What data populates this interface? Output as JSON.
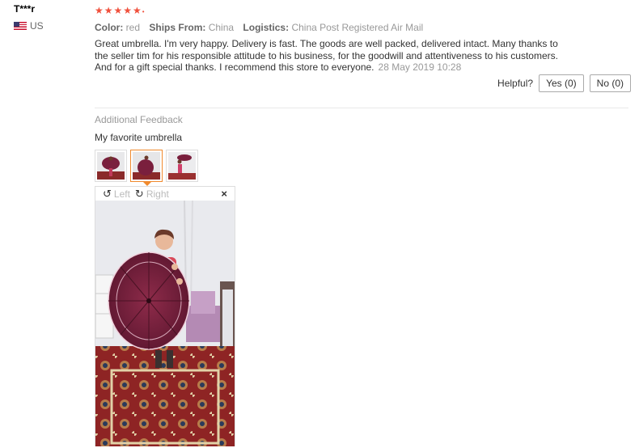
{
  "user": {
    "name": "T***r",
    "country": "US"
  },
  "review": {
    "rating": 5,
    "stars": "★★★★★",
    "color_label": "Color:",
    "color_value": "red",
    "ships_label": "Ships From:",
    "ships_value": "China",
    "logistics_label": "Logistics:",
    "logistics_value": "China Post Registered Air Mail",
    "text": "Great umbrella. I'm very happy. Delivery is fast. The goods are well packed, delivered intact. Many thanks to the seller tim for his responsible attitude to his business, for the goodwill and attentiveness to his customers. And for a gift special thanks. I recommend this store to everyone.",
    "date": "28 May 2019 10:28"
  },
  "helpful": {
    "label": "Helpful?",
    "yes": "Yes (0)",
    "no": "No (0)"
  },
  "additional": {
    "title": "Additional Feedback",
    "text": "My favorite umbrella"
  },
  "viewer": {
    "left_label": "Left",
    "right_label": "Right",
    "close_glyph": "×",
    "left_icon": "↺",
    "right_icon": "↻"
  },
  "colors": {
    "star": "#f0503c",
    "active_thumb": "#f08a2e",
    "umbrella": "#7a1f3d"
  }
}
